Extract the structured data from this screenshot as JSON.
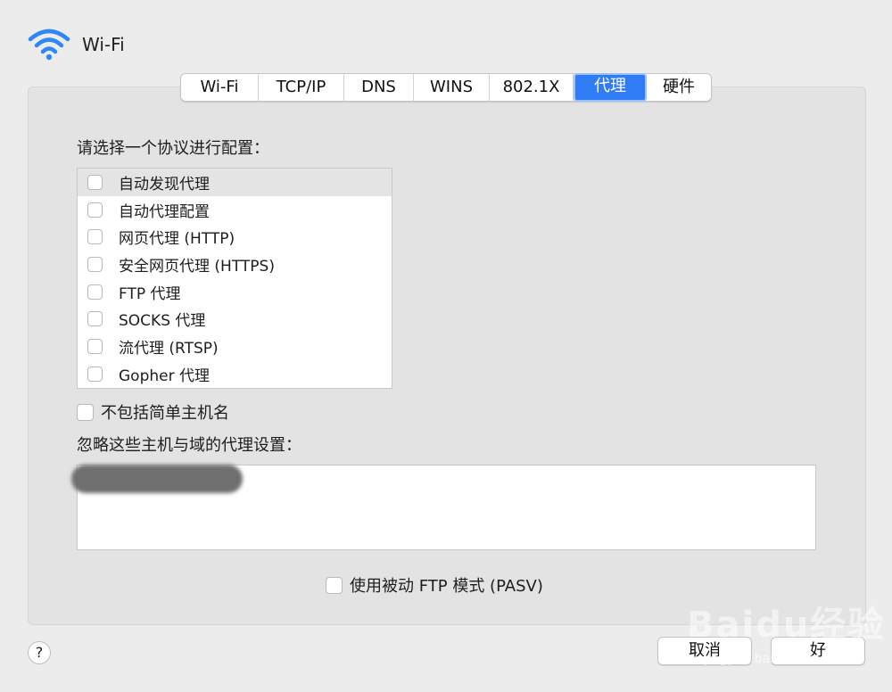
{
  "window": {
    "title": "Wi-Fi",
    "wifi_icon": "wifi-icon"
  },
  "tabs": [
    {
      "label": "Wi-Fi",
      "active": false
    },
    {
      "label": "TCP/IP",
      "active": false
    },
    {
      "label": "DNS",
      "active": false
    },
    {
      "label": "WINS",
      "active": false
    },
    {
      "label": "802.1X",
      "active": false
    },
    {
      "label": "代理",
      "active": true
    },
    {
      "label": "硬件",
      "active": false
    }
  ],
  "protocols": {
    "label": "请选择一个协议进行配置：",
    "items": [
      {
        "label": "自动发现代理",
        "checked": false,
        "selected": true
      },
      {
        "label": "自动代理配置",
        "checked": false,
        "selected": false
      },
      {
        "label": "网页代理 (HTTP)",
        "checked": false,
        "selected": false
      },
      {
        "label": "安全网页代理 (HTTPS)",
        "checked": false,
        "selected": false
      },
      {
        "label": "FTP 代理",
        "checked": false,
        "selected": false
      },
      {
        "label": "SOCKS 代理",
        "checked": false,
        "selected": false
      },
      {
        "label": "流代理 (RTSP)",
        "checked": false,
        "selected": false
      },
      {
        "label": "Gopher 代理",
        "checked": false,
        "selected": false
      }
    ]
  },
  "exclude_simple_hostnames": {
    "label": "不包括简单主机名",
    "checked": false
  },
  "bypass": {
    "label": "忽略这些主机与域的代理设置：",
    "value": ""
  },
  "passive_ftp": {
    "label": "使用被动 FTP 模式 (PASV)",
    "checked": false
  },
  "footer": {
    "help": "?",
    "cancel": "取消",
    "ok": "好"
  },
  "watermark": {
    "brand": "Baidu经验",
    "url": "jingyan.baidu.com"
  },
  "colors": {
    "accent": "#2f7cf6",
    "wifi_icon": "#2f86f6"
  }
}
